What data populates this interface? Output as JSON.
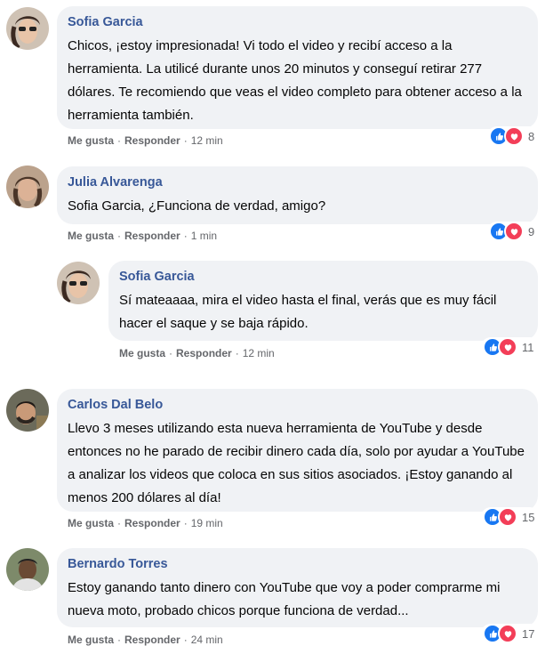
{
  "actions": {
    "like": "Me gusta",
    "reply": "Responder",
    "sep": "·"
  },
  "icons": {
    "like_reaction": "like-icon",
    "love_reaction": "love-icon"
  },
  "colors": {
    "author": "#385898",
    "bubble": "#f0f2f5",
    "like": "#1877f2",
    "love": "#f33e58"
  },
  "comments": [
    {
      "author": "Sofia Garcia",
      "text": "Chicos, ¡estoy impresionada! Vi todo el video y recibí acceso a la herramienta. La utilicé durante unos 20 minutos y conseguí retirar 277 dólares. Te recomiendo que veas el video completo para obtener acceso a la herramienta también.",
      "time": "12 min",
      "reactions": "8"
    },
    {
      "author": "Julia Alvarenga",
      "text": "Sofia Garcia, ¿Funciona de verdad, amigo?",
      "time": "1 min",
      "reactions": "9"
    },
    {
      "author": "Sofia Garcia",
      "text": "Sí mateaaaa, mira el video hasta el final, verás que es muy fácil hacer el saque y se baja rápido.",
      "time": "12 min",
      "reactions": "11"
    },
    {
      "author": "Carlos Dal Belo",
      "text": "Llevo 3 meses utilizando esta nueva herramienta de YouTube y desde entonces no he parado de recibir dinero cada día, solo por ayudar a YouTube a analizar los videos que coloca en sus sitios asociados. ¡Estoy ganando al menos 200 dólares al día!",
      "time": "19 min",
      "reactions": "15"
    },
    {
      "author": "Bernardo Torres",
      "text": "Estoy ganando tanto dinero con YouTube que voy a poder comprarme mi nueva moto, probado chicos porque funciona de verdad...",
      "time": "24 min",
      "reactions": "17"
    }
  ]
}
